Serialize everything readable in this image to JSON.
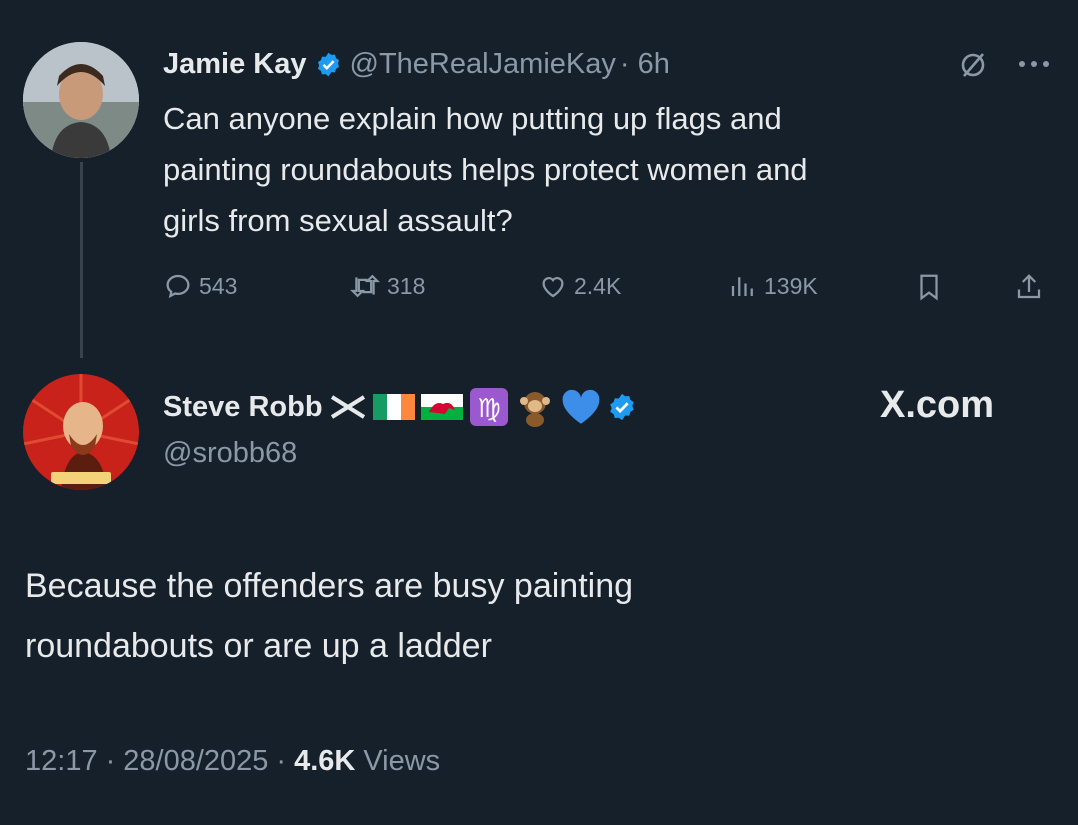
{
  "original_tweet": {
    "author_name": "Jamie Kay",
    "handle": "@TheRealJamieKay",
    "time": "· 6h",
    "text_lines": [
      "Can anyone explain how putting up flags and",
      "painting roundabouts helps protect women and",
      "girls from sexual assault?"
    ],
    "metrics": {
      "replies": "543",
      "reposts": "318",
      "likes": "2.4K",
      "views": "139K"
    }
  },
  "reply": {
    "author_name": "Steve Robb",
    "handle": "@srobb68",
    "text_lines": [
      "Because the offenders are busy painting",
      "roundabouts or are up a ladder"
    ],
    "footer": {
      "time": "12:17",
      "date": "28/08/2025",
      "views_count": "4.6K",
      "views_label": "Views",
      "separator": "·"
    }
  },
  "watermark": "X.com",
  "colors": {
    "background": "#15202b",
    "primary_text": "#e7e9ea",
    "secondary_text": "#8b98a5",
    "verified": "#1d9bf0"
  },
  "icons": [
    "verified-badge-icon",
    "grok-icon",
    "more-icon",
    "reply-icon",
    "repost-icon",
    "like-icon",
    "views-icon",
    "bookmark-icon",
    "share-icon",
    "flag-scotland-icon",
    "flag-ireland-icon",
    "flag-wales-icon",
    "virgo-icon",
    "monkey-icon",
    "blue-heart-icon"
  ]
}
